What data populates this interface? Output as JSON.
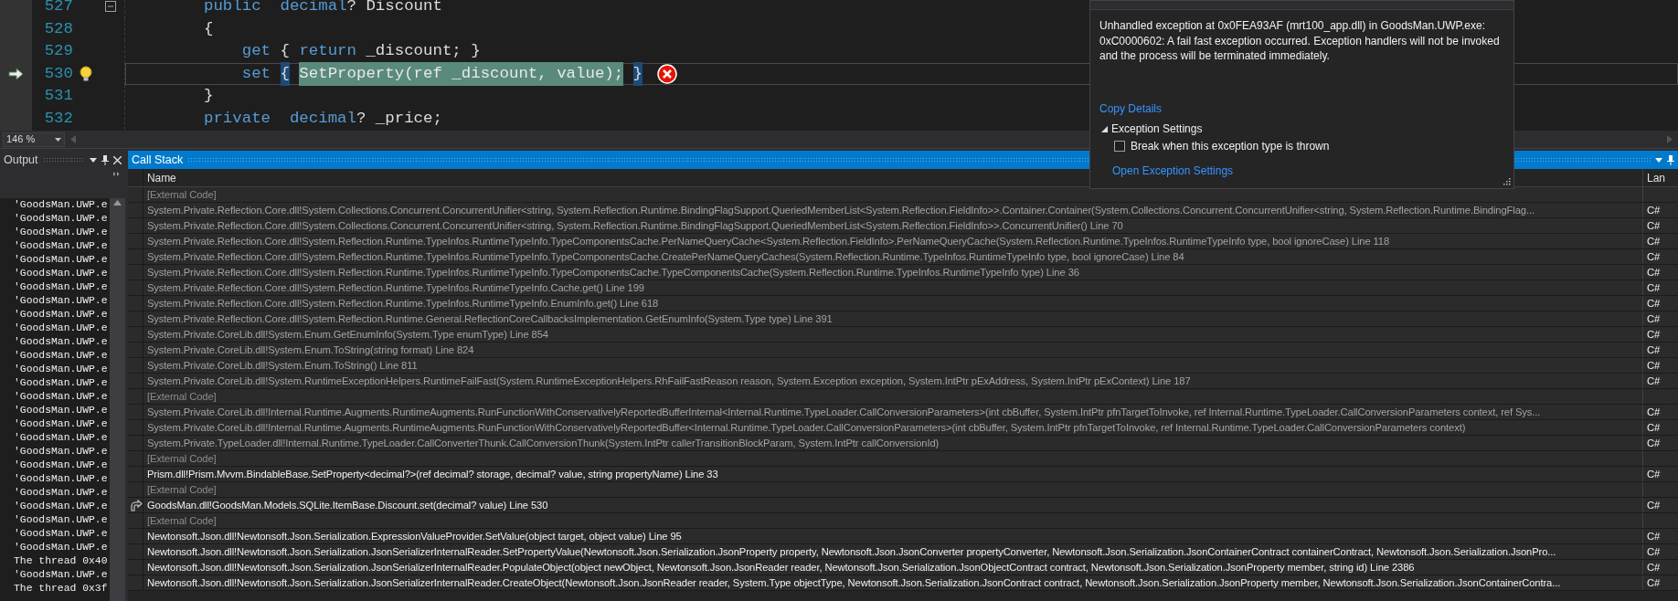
{
  "editor": {
    "lines": [
      {
        "number": "527",
        "current": false,
        "lightbulb": false,
        "error": false,
        "collapsible": true,
        "tokens": [
          {
            "text": "public",
            "kind": "keyword"
          },
          {
            "text": "  decimal",
            "kind": "keyword"
          },
          {
            "text": "? Discount",
            "kind": "plain"
          }
        ]
      },
      {
        "number": "528",
        "current": false,
        "lightbulb": false,
        "error": false,
        "collapsible": false,
        "tokens": [
          {
            "text": "{",
            "kind": "plain"
          }
        ]
      },
      {
        "number": "529",
        "current": false,
        "lightbulb": false,
        "error": false,
        "collapsible": false,
        "tokens": [
          {
            "text": "    get",
            "kind": "keyword"
          },
          {
            "text": " { ",
            "kind": "plain"
          },
          {
            "text": "return",
            "kind": "keyword"
          },
          {
            "text": " _discount; }",
            "kind": "plain"
          }
        ]
      },
      {
        "number": "530",
        "current": true,
        "lightbulb": true,
        "error": true,
        "collapsible": false,
        "tokens": [
          {
            "text": "    set ",
            "kind": "keyword"
          },
          {
            "text": "{",
            "kind": "brace"
          },
          {
            "text": "SetProperty(ref _discount, value);",
            "kind": "statement"
          },
          {
            "text": "}",
            "kind": "brace"
          }
        ]
      },
      {
        "number": "531",
        "current": false,
        "lightbulb": false,
        "error": false,
        "collapsible": false,
        "tokens": [
          {
            "text": "}",
            "kind": "plain"
          }
        ]
      },
      {
        "number": "532",
        "current": false,
        "lightbulb": false,
        "error": false,
        "collapsible": false,
        "tokens": [
          {
            "text": "private",
            "kind": "keyword"
          },
          {
            "text": "  decimal",
            "kind": "keyword"
          },
          {
            "text": "? _price;",
            "kind": "plain"
          }
        ]
      }
    ],
    "zoom": "146 %"
  },
  "output": {
    "title": "Output",
    "lines": [
      "'GoodsMan.UWP.e",
      "'GoodsMan.UWP.e",
      "'GoodsMan.UWP.e",
      "'GoodsMan.UWP.e",
      "'GoodsMan.UWP.e",
      "'GoodsMan.UWP.e",
      "'GoodsMan.UWP.e",
      "'GoodsMan.UWP.e",
      "'GoodsMan.UWP.e",
      "'GoodsMan.UWP.e",
      "'GoodsMan.UWP.e",
      "'GoodsMan.UWP.e",
      "'GoodsMan.UWP.e",
      "'GoodsMan.UWP.e",
      "'GoodsMan.UWP.e",
      "'GoodsMan.UWP.e",
      "'GoodsMan.UWP.e",
      "'GoodsMan.UWP.e",
      "'GoodsMan.UWP.e",
      "'GoodsMan.UWP.e",
      "'GoodsMan.UWP.e",
      "'GoodsMan.UWP.e",
      "'GoodsMan.UWP.e",
      "'GoodsMan.UWP.e",
      "'GoodsMan.UWP.e",
      "'GoodsMan.UWP.e",
      "The thread 0x40",
      "'GoodsMan.UWP.e",
      "The thread 0x3f"
    ]
  },
  "call_stack": {
    "title": "Call Stack",
    "columns": [
      "Name",
      "Lan"
    ],
    "frames": [
      {
        "kind": "external",
        "current": false,
        "name": "[External Code]"
      },
      {
        "kind": "system",
        "current": false,
        "name": "System.Private.Reflection.Core.dll!System.Collections.Concurrent.ConcurrentUnifier<string, System.Reflection.Runtime.BindingFlagSupport.QueriedMemberList<System.Reflection.FieldInfo>>.Container.Container(System.Collections.Concurrent.ConcurrentUnifier<string, System.Reflection.Runtime.BindingFlag...",
        "language": "C#"
      },
      {
        "kind": "system",
        "current": false,
        "name": "System.Private.Reflection.Core.dll!System.Collections.Concurrent.ConcurrentUnifier<string, System.Reflection.Runtime.BindingFlagSupport.QueriedMemberList<System.Reflection.FieldInfo>>.ConcurrentUnifier() Line 70",
        "language": "C#"
      },
      {
        "kind": "system",
        "current": false,
        "name": "System.Private.Reflection.Core.dll!System.Reflection.Runtime.TypeInfos.RuntimeTypeInfo.TypeComponentsCache.PerNameQueryCache<System.Reflection.FieldInfo>.PerNameQueryCache(System.Reflection.Runtime.TypeInfos.RuntimeTypeInfo type, bool ignoreCase) Line 118",
        "language": "C#"
      },
      {
        "kind": "system",
        "current": false,
        "name": "System.Private.Reflection.Core.dll!System.Reflection.Runtime.TypeInfos.RuntimeTypeInfo.TypeComponentsCache.CreatePerNameQueryCaches(System.Reflection.Runtime.TypeInfos.RuntimeTypeInfo type, bool ignoreCase) Line 84",
        "language": "C#"
      },
      {
        "kind": "system",
        "current": false,
        "name": "System.Private.Reflection.Core.dll!System.Reflection.Runtime.TypeInfos.RuntimeTypeInfo.TypeComponentsCache.TypeComponentsCache(System.Reflection.Runtime.TypeInfos.RuntimeTypeInfo type) Line 36",
        "language": "C#"
      },
      {
        "kind": "system",
        "current": false,
        "name": "System.Private.Reflection.Core.dll!System.Reflection.Runtime.TypeInfos.RuntimeTypeInfo.Cache.get() Line 199",
        "language": "C#"
      },
      {
        "kind": "system",
        "current": false,
        "name": "System.Private.Reflection.Core.dll!System.Reflection.Runtime.TypeInfos.RuntimeTypeInfo.EnumInfo.get() Line 618",
        "language": "C#"
      },
      {
        "kind": "system",
        "current": false,
        "name": "System.Private.Reflection.Core.dll!System.Reflection.Runtime.General.ReflectionCoreCallbacksImplementation.GetEnumInfo(System.Type type) Line 391",
        "language": "C#"
      },
      {
        "kind": "system",
        "current": false,
        "name": "System.Private.CoreLib.dll!System.Enum.GetEnumInfo(System.Type enumType) Line 854",
        "language": "C#"
      },
      {
        "kind": "system",
        "current": false,
        "name": "System.Private.CoreLib.dll!System.Enum.ToString(string format) Line 824",
        "language": "C#"
      },
      {
        "kind": "system",
        "current": false,
        "name": "System.Private.CoreLib.dll!System.Enum.ToString() Line 811",
        "language": "C#"
      },
      {
        "kind": "system",
        "current": false,
        "name": "System.Private.CoreLib.dll!System.RuntimeExceptionHelpers.RuntimeFailFast(System.RuntimeExceptionHelpers.RhFailFastReason reason, System.Exception exception, System.IntPtr pExAddress, System.IntPtr pExContext) Line 187",
        "language": "C#"
      },
      {
        "kind": "external",
        "current": false,
        "name": "[External Code]"
      },
      {
        "kind": "system",
        "current": false,
        "name": "System.Private.CoreLib.dll!Internal.Runtime.Augments.RuntimeAugments.RunFunctionWithConservativelyReportedBufferInternal<Internal.Runtime.TypeLoader.CallConversionParameters>(int cbBuffer, System.IntPtr pfnTargetToInvoke, ref Internal.Runtime.TypeLoader.CallConversionParameters context, ref Sys...",
        "language": "C#"
      },
      {
        "kind": "system",
        "current": false,
        "name": "System.Private.CoreLib.dll!Internal.Runtime.Augments.RuntimeAugments.RunFunctionWithConservativelyReportedBuffer<Internal.Runtime.TypeLoader.CallConversionParameters>(int cbBuffer, System.IntPtr pfnTargetToInvoke, ref Internal.Runtime.TypeLoader.CallConversionParameters context)",
        "language": "C#"
      },
      {
        "kind": "system",
        "current": false,
        "name": "System.Private.TypeLoader.dll!Internal.Runtime.TypeLoader.CallConverterThunk.CallConversionThunk(System.IntPtr callerTransitionBlockParam, System.IntPtr callConversionId)",
        "language": "C#"
      },
      {
        "kind": "external",
        "current": false,
        "name": "[External Code]"
      },
      {
        "kind": "user",
        "current": false,
        "name": "Prism.dll!Prism.Mvvm.BindableBase.SetProperty<decimal?>(ref decimal? storage, decimal? value, string propertyName) Line 33",
        "language": "C#"
      },
      {
        "kind": "external",
        "current": false,
        "name": "[External Code]"
      },
      {
        "kind": "user",
        "current": true,
        "name": "GoodsMan.dll!GoodsMan.Models.SQLite.ItemBase.Discount.set(decimal? value) Line 530",
        "language": "C#"
      },
      {
        "kind": "external",
        "current": false,
        "name": "[External Code]"
      },
      {
        "kind": "user",
        "current": false,
        "name": "Newtonsoft.Json.dll!Newtonsoft.Json.Serialization.ExpressionValueProvider.SetValue(object target, object value) Line 95",
        "language": "C#"
      },
      {
        "kind": "user",
        "current": false,
        "name": "Newtonsoft.Json.dll!Newtonsoft.Json.Serialization.JsonSerializerInternalReader.SetPropertyValue(Newtonsoft.Json.Serialization.JsonProperty property, Newtonsoft.Json.JsonConverter propertyConverter, Newtonsoft.Json.Serialization.JsonContainerContract containerContract, Newtonsoft.Json.Serialization.JsonPro...",
        "language": "C#"
      },
      {
        "kind": "user",
        "current": false,
        "name": "Newtonsoft.Json.dll!Newtonsoft.Json.Serialization.JsonSerializerInternalReader.PopulateObject(object newObject, Newtonsoft.Json.JsonReader reader, Newtonsoft.Json.Serialization.JsonObjectContract contract, Newtonsoft.Json.Serialization.JsonProperty member, string id) Line 2386",
        "language": "C#"
      },
      {
        "kind": "user",
        "current": false,
        "name": "Newtonsoft.Json.dll!Newtonsoft.Json.Serialization.JsonSerializerInternalReader.CreateObject(Newtonsoft.Json.JsonReader reader, System.Type objectType, Newtonsoft.Json.Serialization.JsonContract contract, Newtonsoft.Json.Serialization.JsonProperty member, Newtonsoft.Json.Serialization.JsonContainerContra...",
        "language": "C#"
      }
    ]
  },
  "exception": {
    "message": "Unhandled exception at 0x0FEA93AF (mrt100_app.dll) in GoodsMan.UWP.exe: 0xC0000602:  A fail fast exception occurred. Exception handlers will not be invoked and the process will be terminated immediately.",
    "copy_details": "Copy Details",
    "settings_title": "Exception Settings",
    "settings_expanded": true,
    "break_option": {
      "label": "Break when this exception type is thrown",
      "checked": false
    },
    "open_settings": "Open Exception Settings"
  }
}
